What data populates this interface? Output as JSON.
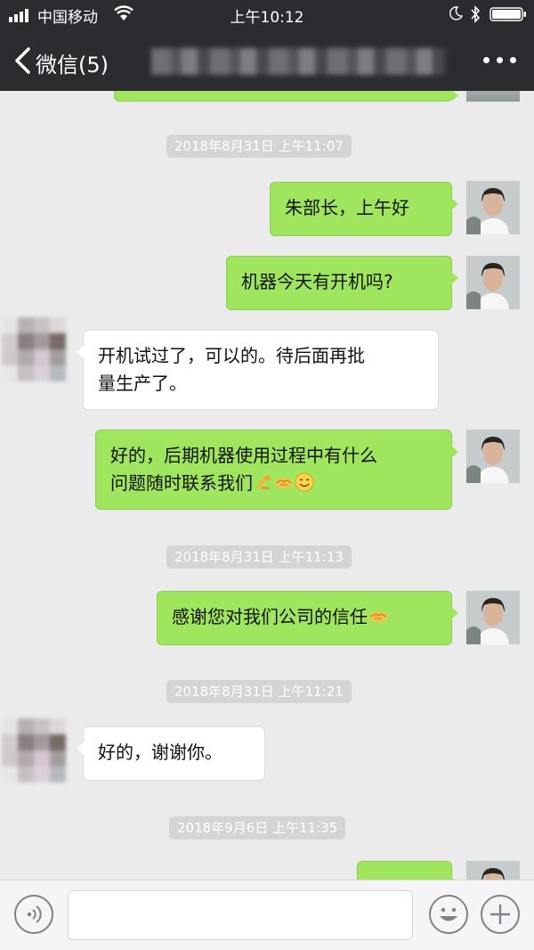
{
  "status_bar": {
    "carrier": "中国移动",
    "time": "上午10:12"
  },
  "nav": {
    "back_label": "微信(5)"
  },
  "messages": [
    {
      "type": "timestamp",
      "text": "2018年8月31日 上午11:07"
    },
    {
      "type": "sent",
      "lines": [
        "朱部长，上午好"
      ]
    },
    {
      "type": "sent",
      "lines": [
        "机器今天有开机吗?"
      ]
    },
    {
      "type": "received",
      "lines": [
        "开机试过了，可以的。待后面再批",
        "量生产了。"
      ]
    },
    {
      "type": "sent",
      "lines": [
        "好的，后期机器使用过程中有什么",
        "问题随时联系我们"
      ],
      "emojis": [
        "fist-bump-emoji",
        "handshake-emoji",
        "smile-emoji"
      ]
    },
    {
      "type": "timestamp",
      "text": "2018年8月31日 上午11:13"
    },
    {
      "type": "sent",
      "lines": [
        "感谢您对我们公司的信任"
      ],
      "emojis": [
        "handshake-emoji"
      ]
    },
    {
      "type": "timestamp",
      "text": "2018年8月31日 上午11:21"
    },
    {
      "type": "received",
      "lines": [
        "好的，谢谢你。"
      ]
    },
    {
      "type": "timestamp",
      "text": "2018年9月6日 上午11:35"
    }
  ],
  "input_bar": {
    "value": "",
    "left_icon": "voice-icon",
    "right_icons": [
      "emoji-icon",
      "plus-icon"
    ]
  },
  "colors": {
    "nav_background": "#2b2c30",
    "chat_background": "#ebebeb",
    "sent_bubble": "#9fe55d",
    "received_bubble": "#ffffff",
    "timestamp_background": "#d4d4d4"
  }
}
